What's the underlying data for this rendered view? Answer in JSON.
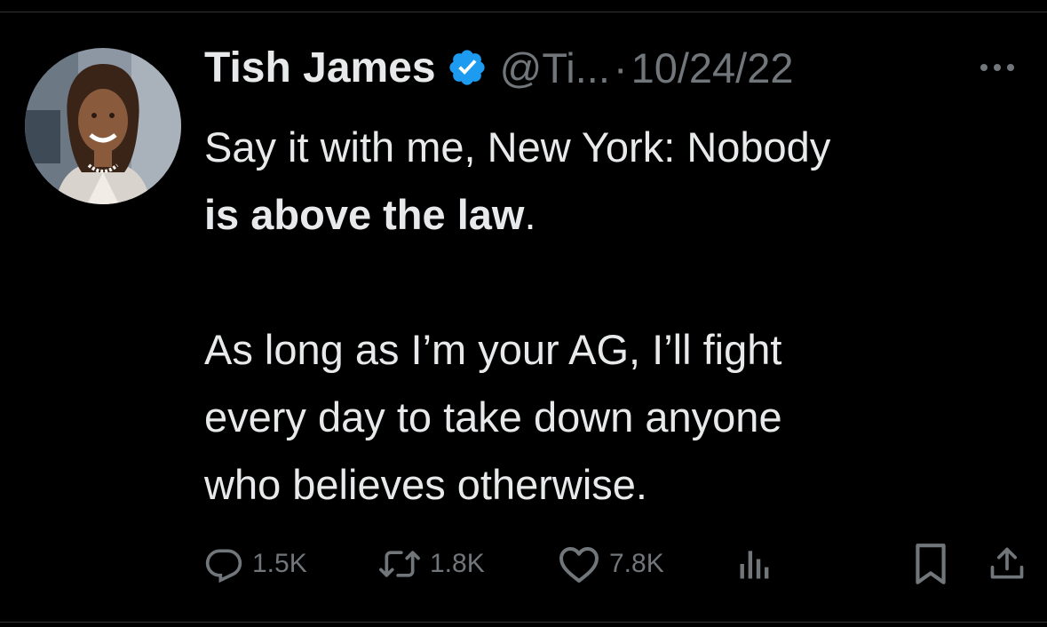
{
  "tweet": {
    "author": {
      "name": "Tish James",
      "handle": "@Ti...",
      "verified": true,
      "verified_color": "#1d9bf0"
    },
    "separator": "·",
    "date": "10/24/22",
    "text": {
      "line1_regular": "Say it with me, New York: Nobody",
      "line2_bold": "is above the law",
      "line2_tail": ".",
      "para2_line1": "As long as I’m your AG, I’ll fight",
      "para2_line2": "every day to take down anyone",
      "para2_line3": "who believes otherwise."
    },
    "stats": {
      "replies": "1.5K",
      "reposts": "1.8K",
      "likes": "7.8K"
    }
  },
  "theme": {
    "background": "#000000",
    "text": "#e7e9ea",
    "muted": "#71767b",
    "divider": "#2f3336"
  },
  "icons": {
    "reply": "reply-icon",
    "repost": "repost-icon",
    "like": "like-icon",
    "views": "views-icon",
    "bookmark": "bookmark-icon",
    "share": "share-icon",
    "more": "more-icon",
    "verified": "verified-badge-icon"
  }
}
